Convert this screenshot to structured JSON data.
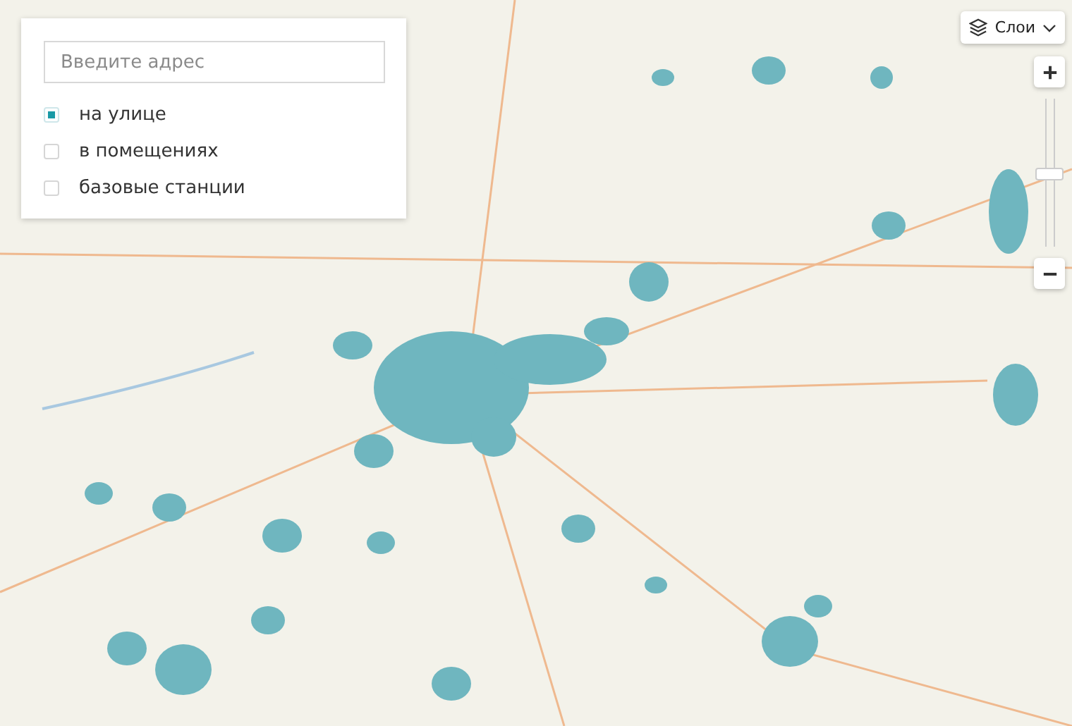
{
  "search": {
    "placeholder": "Введите адрес"
  },
  "filters": [
    {
      "label": "на улице",
      "selected": true
    },
    {
      "label": "в помещениях",
      "selected": false
    },
    {
      "label": "базовые станции",
      "selected": false
    }
  ],
  "layers_button": {
    "label": "Слои"
  },
  "zoom": {
    "level": 0.44
  }
}
